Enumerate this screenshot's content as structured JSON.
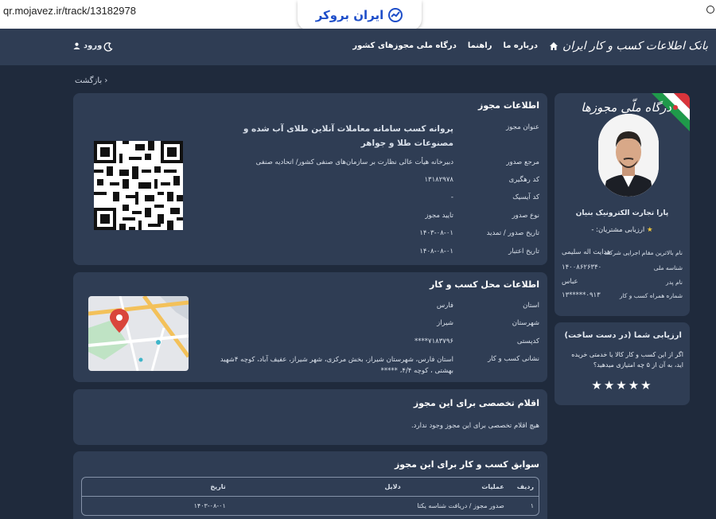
{
  "browser": {
    "url": "qr.mojavez.ir/track/13182978",
    "brand": "ایران بروکر"
  },
  "nav": {
    "logo": "بانک اطلاعات کسب و کار ایران",
    "links": [
      "درباره ما",
      "راهنما",
      "درگاه ملی مجوزهای کشور"
    ],
    "login": "ورود"
  },
  "back": "بازگشت",
  "license": {
    "title": "اطلاعات مجوز",
    "rows": [
      {
        "label": "عنوان مجوز",
        "value": "پروانه کسب سامانه معاملات آنلاین طلای آب شده و مصنوعات طلا و جواهر"
      },
      {
        "label": "مرجع صدور",
        "value": "دبیرخانه هیأت عالی نظارت بر سازمان‌های صنفی کشور/ اتحادیه صنفی"
      },
      {
        "label": "کد رهگیری",
        "value": "۱۳۱۸۲۹۷۸"
      },
      {
        "label": "کد آیسیک",
        "value": "-"
      },
      {
        "label": "نوع صدور",
        "value": "تایید مجوز"
      },
      {
        "label": "تاریخ صدور / تمدید",
        "value": "۱۴۰۳-۰۸-۰۱"
      },
      {
        "label": "تاریخ اعتبار",
        "value": "۱۴۰۸-۰۸-۰۱"
      }
    ]
  },
  "location": {
    "title": "اطلاعات محل کسب و کار",
    "rows": [
      {
        "label": "استان",
        "value": "فارس"
      },
      {
        "label": "شهرستان",
        "value": "شیراز"
      },
      {
        "label": "کدپستی",
        "value": "۷۱۸۳۷۹۶****"
      },
      {
        "label": "نشانی کسب و کار",
        "value": "استان فارس، شهرستان شیراز، بخش مرکزی، شهر شیراز، عفیف آباد، کوچه ۴شهید بهشتی ، کوچه ۴/۴، *****"
      }
    ]
  },
  "special": {
    "title": "اقلام تخصصی برای این مجوز",
    "text": "هیچ اقلام تخصصی برای این مجوز وجود ندارد."
  },
  "history": {
    "title": "سوابق کسب و کار برای این مجوز",
    "headers": [
      "ردیف",
      "عملیات",
      "دلایل",
      "تاریخ"
    ],
    "rows": [
      [
        "۱",
        "صدور مجوز / دریافت شناسه یکتا",
        "",
        "۱۴۰۳-۰۸-۰۱"
      ]
    ]
  },
  "profile": {
    "sign_title": "درگاه ملّی مجوزها",
    "company": "پارا تجارت الکترونیک بنیان",
    "rating_text": "ارزیابی مشتریان: -",
    "rows": [
      {
        "label": "نام بالاترین مقام اجرایی شرکت",
        "value": "هدایت اله سلیمی"
      },
      {
        "label": "شناسه ملی",
        "value": "۱۴۰۰۸۶۲۶۳۴۰"
      },
      {
        "label": "نام پدر",
        "value": "عباس"
      },
      {
        "label": "شماره همراه کسب و کار",
        "value": "۰۹۱۳*****۱۳"
      }
    ]
  },
  "review": {
    "title": "ارزیابی شما (در دست ساخت)",
    "text": "اگر از این کسب و کار کالا یا خدمتی خریده اید، به آن از ۵ چه امتیازی میدهید؟",
    "stars": "★★★★★"
  },
  "colors": {
    "background": "#1f2a3c",
    "card": "#2f3d54",
    "map_pin": "#d9453b"
  }
}
